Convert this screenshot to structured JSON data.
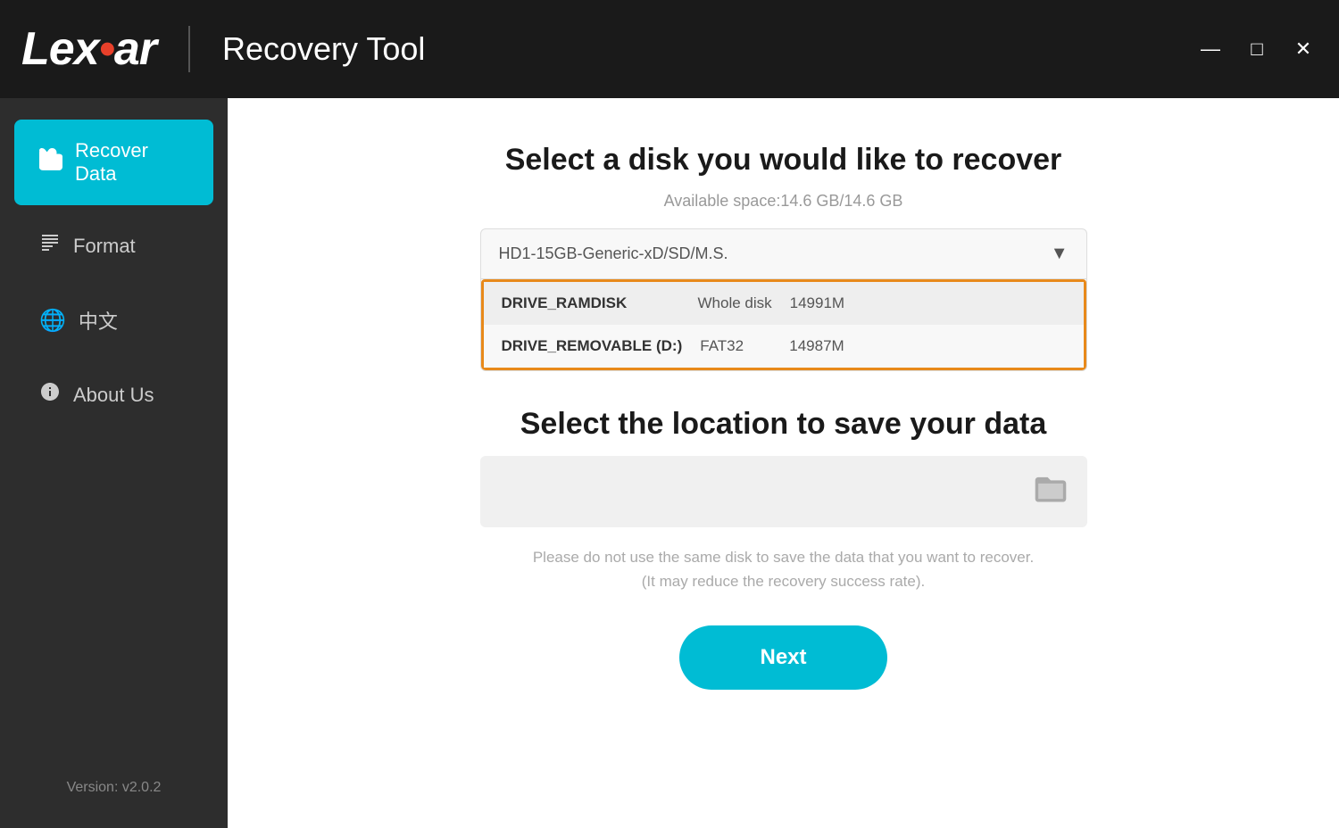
{
  "titleBar": {
    "logoText": "Lex",
    "logoDot": "•",
    "logoText2": "ar",
    "divider": "|",
    "appTitle": "Recovery Tool",
    "windowControls": {
      "minimize": "—",
      "maximize": "□",
      "close": "✕"
    }
  },
  "sidebar": {
    "items": [
      {
        "id": "recover-data",
        "label": "Recover Data",
        "icon": "🗂",
        "active": true
      },
      {
        "id": "format",
        "label": "Format",
        "icon": "⊞",
        "active": false
      },
      {
        "id": "language",
        "label": "中文",
        "icon": "🌐",
        "active": false
      },
      {
        "id": "about-us",
        "label": "About Us",
        "icon": "ℹ",
        "active": false
      }
    ],
    "version": "Version: v2.0.2"
  },
  "content": {
    "diskSection": {
      "title": "Select a disk you would like to recover",
      "availableSpace": "Available space:14.6 GB/14.6 GB",
      "dropdownValue": "HD1-15GB-Generic-xD/SD/M.S.",
      "diskRows": [
        {
          "name": "DRIVE_RAMDISK",
          "type": "Whole disk",
          "size": "14991M"
        },
        {
          "name": "DRIVE_REMOVABLE (D:)",
          "type": "FAT32",
          "size": "14987M"
        }
      ]
    },
    "locationSection": {
      "title": "Select the location to save your data",
      "warningLine1": "Please do not use the same disk to save the data that you want to recover.",
      "warningLine2": "(It may reduce the recovery success rate)."
    },
    "nextButton": "Next"
  }
}
